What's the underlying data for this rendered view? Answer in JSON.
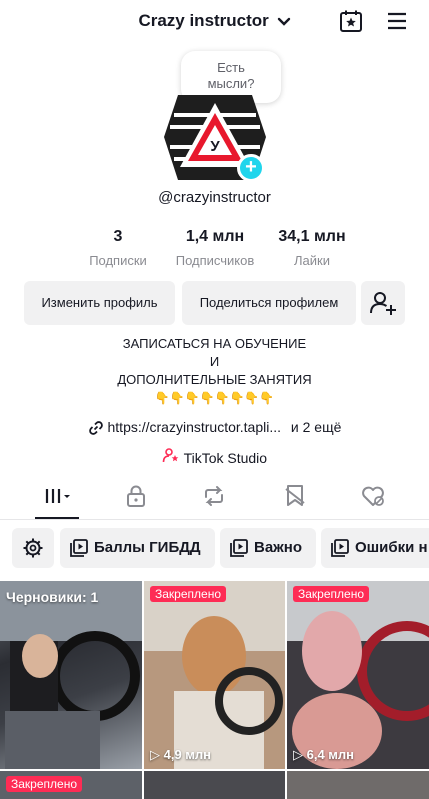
{
  "header": {
    "title": "Crazy instructor"
  },
  "bubble": {
    "line1": "Есть",
    "line2": "мысли?"
  },
  "profile": {
    "username": "@crazyinstructor",
    "avatar_letter": "У"
  },
  "stats": [
    {
      "value": "3",
      "label": "Подписки"
    },
    {
      "value": "1,4 млн",
      "label": "Подписчиков"
    },
    {
      "value": "34,1 млн",
      "label": "Лайки"
    }
  ],
  "buttons": {
    "edit": "Изменить профиль",
    "share": "Поделиться профилем"
  },
  "bio": {
    "line1": "ЗАПИСАТЬСЯ НА ОБУЧЕНИЕ",
    "line2": "И",
    "line3": "ДОПОЛНИТЕЛЬНЫЕ ЗАНЯТИЯ",
    "line4": "👇👇👇👇👇👇👇👇"
  },
  "link": {
    "url": "https://crazyinstructor.tapli...",
    "more": "и 2 ещё"
  },
  "studio": {
    "label": "TikTok Studio"
  },
  "chips": [
    "Баллы ГИБДД",
    "Важно",
    "Ошибки н"
  ],
  "grid": {
    "drafts_label": "Черновики: 1",
    "pinned_label": "Закреплено",
    "views": [
      "4,9 млн",
      "6,4 млн"
    ]
  },
  "colors": {
    "accent": "#fe2c55",
    "plus": "#20d5ec"
  }
}
